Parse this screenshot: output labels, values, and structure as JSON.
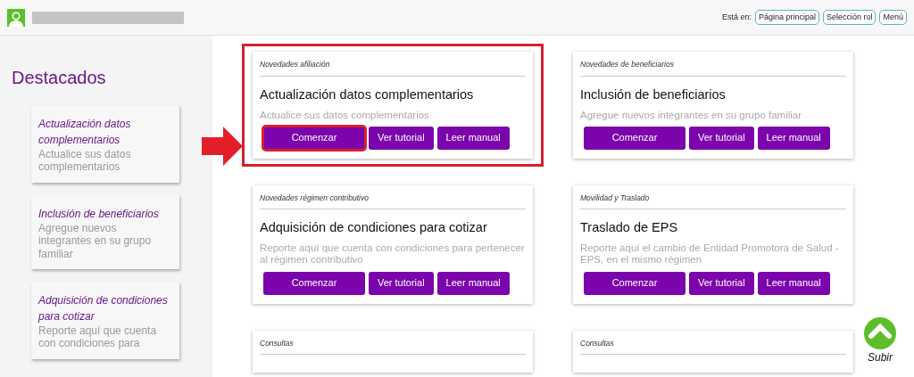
{
  "header": {
    "breadcrumb_label": "Está en:",
    "breadcrumb_links": [
      "Página principal",
      "Selección rol",
      "Menú"
    ]
  },
  "sidebar": {
    "title": "Destacados",
    "items": [
      {
        "title": "Actualización datos complementarios",
        "description": "Actualice sus datos complementarios"
      },
      {
        "title": "Inclusión de beneficiarios",
        "description": "Agregue nuevos integrantes en su grupo familiar"
      },
      {
        "title": "Adquisición de condiciones para cotizar",
        "description": "Reporte aquí que cuenta con condiciones para"
      }
    ]
  },
  "cards": [
    {
      "category": "Novedades afiliación",
      "title": "Actualización datos complementarios",
      "description": "Actualice sus datos complementarios",
      "highlighted": true,
      "buttons": [
        {
          "label": "Comenzar",
          "highlighted": true
        },
        {
          "label": "Ver tutorial",
          "highlighted": false
        },
        {
          "label": "Leer manual",
          "highlighted": false
        }
      ]
    },
    {
      "category": "Novedades de beneficiarios",
      "title": "Inclusión de beneficiarios",
      "description": "Agregue nuevos integrantes en su grupo familiar",
      "highlighted": false,
      "buttons": [
        {
          "label": "Comenzar",
          "highlighted": false
        },
        {
          "label": "Ver tutorial",
          "highlighted": false
        },
        {
          "label": "Leer manual",
          "highlighted": false
        }
      ]
    },
    {
      "category": "Novedades régimen contributivo",
      "title": "Adquisición de condiciones para cotizar",
      "description": "Reporte aquí que cuenta con condiciones para pertenecer al régimen contributivo",
      "highlighted": false,
      "buttons": [
        {
          "label": "Comenzar",
          "highlighted": false
        },
        {
          "label": "Ver tutorial",
          "highlighted": false
        },
        {
          "label": "Leer manual",
          "highlighted": false
        }
      ]
    },
    {
      "category": "Movilidad y Traslado",
      "title": "Traslado de EPS",
      "description": "Reporte aquí el cambio de Entidad Promotora de Salud - EPS, en el mismo régimen",
      "highlighted": false,
      "buttons": [
        {
          "label": "Comenzar",
          "highlighted": false
        },
        {
          "label": "Ver tutorial",
          "highlighted": false
        },
        {
          "label": "Leer manual",
          "highlighted": false
        }
      ]
    },
    {
      "category": "Consultas",
      "highlighted": false
    },
    {
      "category": "Consultas",
      "highlighted": false
    }
  ],
  "scroll_top": {
    "label": "Subir"
  }
}
